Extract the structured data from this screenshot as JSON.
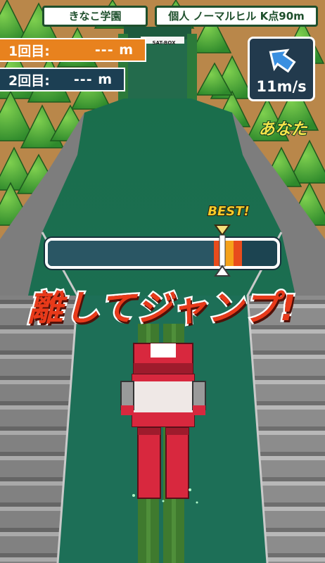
{
  "header": {
    "team": "きなこ学園",
    "event": "個人 ノーマルヒル K点90m"
  },
  "rounds": [
    {
      "label": "1回目:",
      "value": "--- m"
    },
    {
      "label": "2回目:",
      "value": "--- m"
    }
  ],
  "wind": {
    "speed": "11m/s"
  },
  "player_label": "あなた",
  "gauge": {
    "best_label": "BEST!",
    "fill_fraction": 0.75,
    "marker_fraction": 0.76,
    "zone_color": "#e84c1c",
    "zone_center_color": "#f5a21a"
  },
  "instruction": "離してジャンプ!",
  "sponsor": "SAT-BOX",
  "colors": {
    "slope": "#1f6b52",
    "team_orange": "#e8821e",
    "panel_navy": "#1c3f53",
    "jumper_red": "#d8283e"
  }
}
